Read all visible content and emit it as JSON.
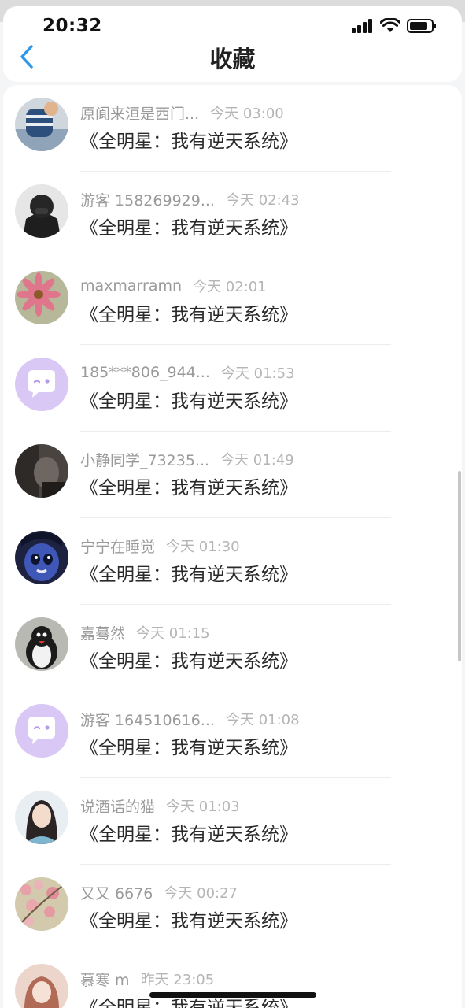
{
  "status_bar": {
    "time": "20:32"
  },
  "header": {
    "title": "收藏"
  },
  "colors": {
    "accent": "#2f96e8",
    "chat_avatar_bg": "#d9c8f5"
  },
  "favorites": [
    {
      "name": "原阆来洹是西门...",
      "time": "今天 03:00",
      "book": "《全明星：我有逆天系统》"
    },
    {
      "name": "游客 158269929...",
      "time": "今天 02:43",
      "book": "《全明星：我有逆天系统》"
    },
    {
      "name": "maxmarramn",
      "time": "今天 02:01",
      "book": "《全明星：我有逆天系统》"
    },
    {
      "name": "185***806_944...",
      "time": "今天 01:53",
      "book": "《全明星：我有逆天系统》"
    },
    {
      "name": "小静同学_73235...",
      "time": "今天 01:49",
      "book": "《全明星：我有逆天系统》"
    },
    {
      "name": "宁宁在睡觉",
      "time": "今天 01:30",
      "book": "《全明星：我有逆天系统》"
    },
    {
      "name": "嘉蓦然",
      "time": "今天 01:15",
      "book": "《全明星：我有逆天系统》"
    },
    {
      "name": "游客 164510616...",
      "time": "今天 01:08",
      "book": "《全明星：我有逆天系统》"
    },
    {
      "name": "说酒话的猫",
      "time": "今天 01:03",
      "book": "《全明星：我有逆天系统》"
    },
    {
      "name": "又又 6676",
      "time": "今天 00:27",
      "book": "《全明星：我有逆天系统》"
    },
    {
      "name": "慕寒 m",
      "time": "昨天 23:05",
      "book": "《全明星：我有逆天系统》"
    }
  ]
}
